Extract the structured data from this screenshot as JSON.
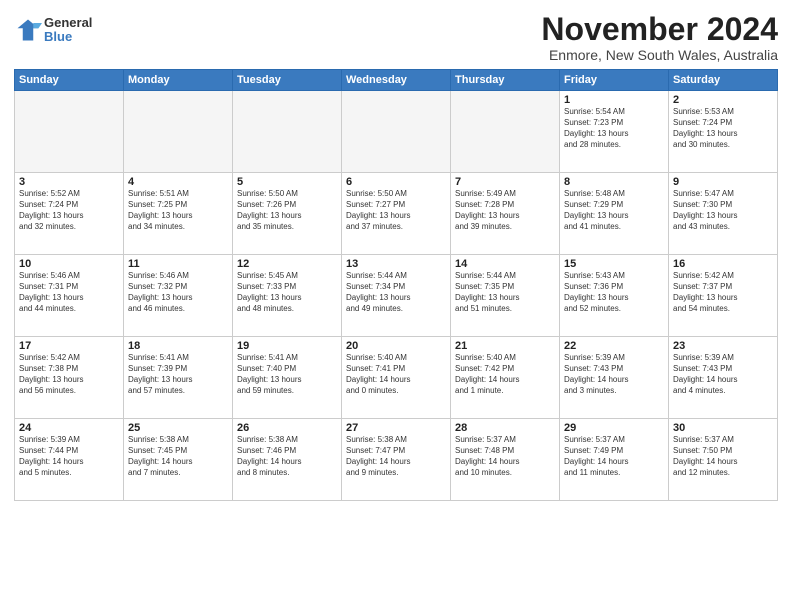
{
  "logo": {
    "general": "General",
    "blue": "Blue"
  },
  "title": "November 2024",
  "location": "Enmore, New South Wales, Australia",
  "days_of_week": [
    "Sunday",
    "Monday",
    "Tuesday",
    "Wednesday",
    "Thursday",
    "Friday",
    "Saturday"
  ],
  "weeks": [
    [
      {
        "day": "",
        "info": "",
        "empty": true
      },
      {
        "day": "",
        "info": "",
        "empty": true
      },
      {
        "day": "",
        "info": "",
        "empty": true
      },
      {
        "day": "",
        "info": "",
        "empty": true
      },
      {
        "day": "",
        "info": "",
        "empty": true
      },
      {
        "day": "1",
        "info": "Sunrise: 5:54 AM\nSunset: 7:23 PM\nDaylight: 13 hours\nand 28 minutes."
      },
      {
        "day": "2",
        "info": "Sunrise: 5:53 AM\nSunset: 7:24 PM\nDaylight: 13 hours\nand 30 minutes."
      }
    ],
    [
      {
        "day": "3",
        "info": "Sunrise: 5:52 AM\nSunset: 7:24 PM\nDaylight: 13 hours\nand 32 minutes."
      },
      {
        "day": "4",
        "info": "Sunrise: 5:51 AM\nSunset: 7:25 PM\nDaylight: 13 hours\nand 34 minutes."
      },
      {
        "day": "5",
        "info": "Sunrise: 5:50 AM\nSunset: 7:26 PM\nDaylight: 13 hours\nand 35 minutes."
      },
      {
        "day": "6",
        "info": "Sunrise: 5:50 AM\nSunset: 7:27 PM\nDaylight: 13 hours\nand 37 minutes."
      },
      {
        "day": "7",
        "info": "Sunrise: 5:49 AM\nSunset: 7:28 PM\nDaylight: 13 hours\nand 39 minutes."
      },
      {
        "day": "8",
        "info": "Sunrise: 5:48 AM\nSunset: 7:29 PM\nDaylight: 13 hours\nand 41 minutes."
      },
      {
        "day": "9",
        "info": "Sunrise: 5:47 AM\nSunset: 7:30 PM\nDaylight: 13 hours\nand 43 minutes."
      }
    ],
    [
      {
        "day": "10",
        "info": "Sunrise: 5:46 AM\nSunset: 7:31 PM\nDaylight: 13 hours\nand 44 minutes."
      },
      {
        "day": "11",
        "info": "Sunrise: 5:46 AM\nSunset: 7:32 PM\nDaylight: 13 hours\nand 46 minutes."
      },
      {
        "day": "12",
        "info": "Sunrise: 5:45 AM\nSunset: 7:33 PM\nDaylight: 13 hours\nand 48 minutes."
      },
      {
        "day": "13",
        "info": "Sunrise: 5:44 AM\nSunset: 7:34 PM\nDaylight: 13 hours\nand 49 minutes."
      },
      {
        "day": "14",
        "info": "Sunrise: 5:44 AM\nSunset: 7:35 PM\nDaylight: 13 hours\nand 51 minutes."
      },
      {
        "day": "15",
        "info": "Sunrise: 5:43 AM\nSunset: 7:36 PM\nDaylight: 13 hours\nand 52 minutes."
      },
      {
        "day": "16",
        "info": "Sunrise: 5:42 AM\nSunset: 7:37 PM\nDaylight: 13 hours\nand 54 minutes."
      }
    ],
    [
      {
        "day": "17",
        "info": "Sunrise: 5:42 AM\nSunset: 7:38 PM\nDaylight: 13 hours\nand 56 minutes."
      },
      {
        "day": "18",
        "info": "Sunrise: 5:41 AM\nSunset: 7:39 PM\nDaylight: 13 hours\nand 57 minutes."
      },
      {
        "day": "19",
        "info": "Sunrise: 5:41 AM\nSunset: 7:40 PM\nDaylight: 13 hours\nand 59 minutes."
      },
      {
        "day": "20",
        "info": "Sunrise: 5:40 AM\nSunset: 7:41 PM\nDaylight: 14 hours\nand 0 minutes."
      },
      {
        "day": "21",
        "info": "Sunrise: 5:40 AM\nSunset: 7:42 PM\nDaylight: 14 hours\nand 1 minute."
      },
      {
        "day": "22",
        "info": "Sunrise: 5:39 AM\nSunset: 7:43 PM\nDaylight: 14 hours\nand 3 minutes."
      },
      {
        "day": "23",
        "info": "Sunrise: 5:39 AM\nSunset: 7:43 PM\nDaylight: 14 hours\nand 4 minutes."
      }
    ],
    [
      {
        "day": "24",
        "info": "Sunrise: 5:39 AM\nSunset: 7:44 PM\nDaylight: 14 hours\nand 5 minutes."
      },
      {
        "day": "25",
        "info": "Sunrise: 5:38 AM\nSunset: 7:45 PM\nDaylight: 14 hours\nand 7 minutes."
      },
      {
        "day": "26",
        "info": "Sunrise: 5:38 AM\nSunset: 7:46 PM\nDaylight: 14 hours\nand 8 minutes."
      },
      {
        "day": "27",
        "info": "Sunrise: 5:38 AM\nSunset: 7:47 PM\nDaylight: 14 hours\nand 9 minutes."
      },
      {
        "day": "28",
        "info": "Sunrise: 5:37 AM\nSunset: 7:48 PM\nDaylight: 14 hours\nand 10 minutes."
      },
      {
        "day": "29",
        "info": "Sunrise: 5:37 AM\nSunset: 7:49 PM\nDaylight: 14 hours\nand 11 minutes."
      },
      {
        "day": "30",
        "info": "Sunrise: 5:37 AM\nSunset: 7:50 PM\nDaylight: 14 hours\nand 12 minutes."
      }
    ]
  ]
}
